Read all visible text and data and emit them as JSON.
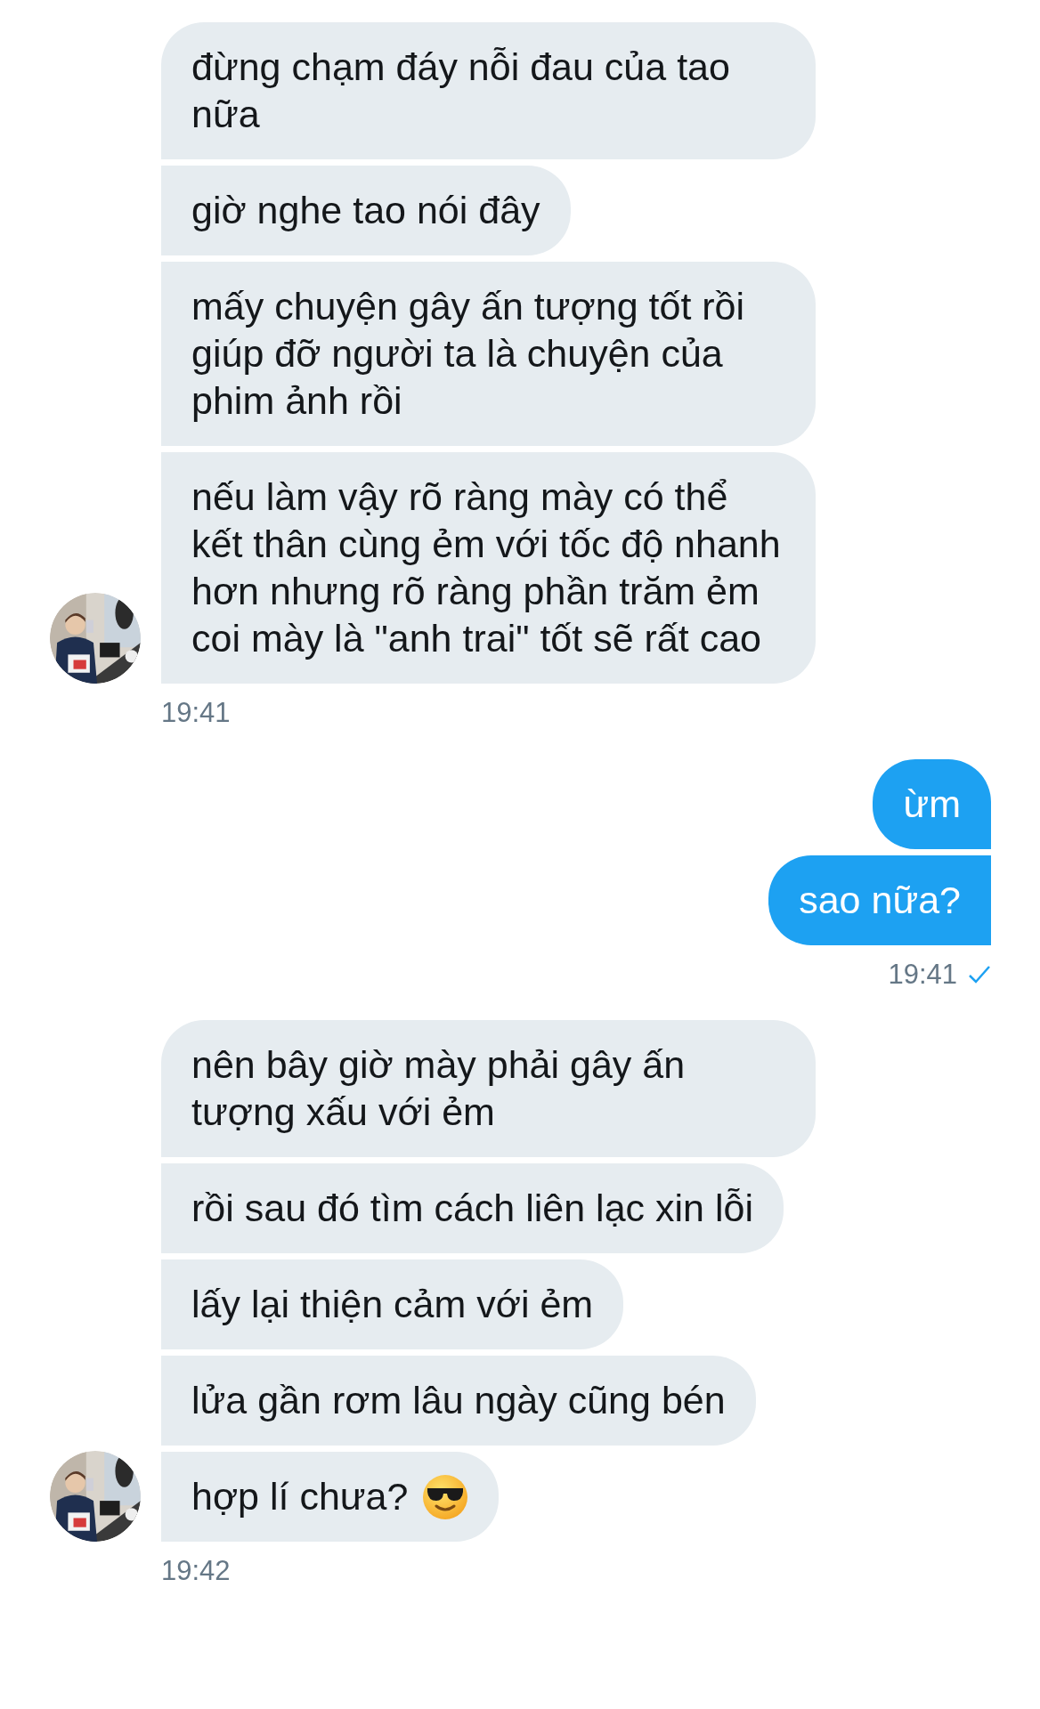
{
  "groups": [
    {
      "kind": "incoming",
      "messages": [
        {
          "text": "đừng chạm đáy nỗi đau của tao nữa"
        },
        {
          "text": "giờ nghe tao nói đây"
        },
        {
          "text": "mấy chuyện gây ấn tượng tốt rồi giúp đỡ người ta là chuyện của phim ảnh rồi"
        },
        {
          "text": "nếu làm vậy rõ ràng mày có thể kết thân cùng ẻm với tốc độ nhanh hơn nhưng rõ ràng phần trăm ẻm coi mày là \"anh trai\" tốt sẽ rất cao"
        }
      ],
      "time": "19:41"
    },
    {
      "kind": "outgoing",
      "messages": [
        {
          "text": "ừm"
        },
        {
          "text": "sao nữa?"
        }
      ],
      "time": "19:41",
      "read": true
    },
    {
      "kind": "incoming",
      "messages": [
        {
          "text": "nên bây giờ mày phải gây ấn tượng xấu với ẻm"
        },
        {
          "text": "rồi sau đó tìm cách liên lạc xin lỗi"
        },
        {
          "text": "lấy lại thiện cảm với ẻm"
        },
        {
          "text": "lửa gần rơm lâu ngày cũng bén"
        },
        {
          "text": "hợp lí chưa?",
          "emoji": true
        }
      ],
      "time": "19:42"
    }
  ]
}
